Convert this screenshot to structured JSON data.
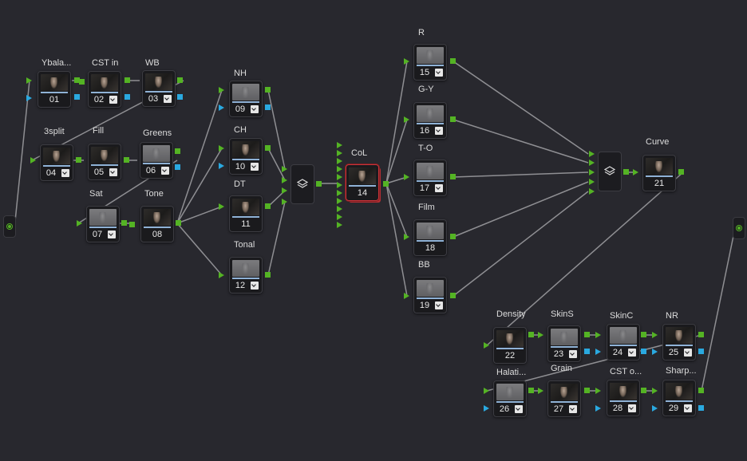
{
  "colors": {
    "background": "#28282e",
    "rgb_port": "#54b324",
    "alpha_port": "#2aa9e0",
    "selected_border": "#c8343a"
  },
  "nodes": [
    {
      "id": "n01",
      "number": "01",
      "label": "Ybala...",
      "thumb": "dark",
      "dropdown": false
    },
    {
      "id": "n02",
      "number": "02",
      "label": "CST in",
      "thumb": "dark",
      "dropdown": true
    },
    {
      "id": "n03",
      "number": "03",
      "label": "WB",
      "thumb": "dark",
      "dropdown": true
    },
    {
      "id": "n04",
      "number": "04",
      "label": "3split",
      "thumb": "dark",
      "dropdown": true
    },
    {
      "id": "n05",
      "number": "05",
      "label": "Fill",
      "thumb": "dark",
      "dropdown": true
    },
    {
      "id": "n06",
      "number": "06",
      "label": "Greens",
      "thumb": "gray",
      "dropdown": true
    },
    {
      "id": "n07",
      "number": "07",
      "label": "Sat",
      "thumb": "gray",
      "dropdown": true
    },
    {
      "id": "n08",
      "number": "08",
      "label": "Tone",
      "thumb": "dark",
      "dropdown": false
    },
    {
      "id": "n09",
      "number": "09",
      "label": "NH",
      "thumb": "gray",
      "dropdown": true
    },
    {
      "id": "n10",
      "number": "10",
      "label": "CH",
      "thumb": "dark",
      "dropdown": true
    },
    {
      "id": "n11",
      "number": "11",
      "label": "DT",
      "thumb": "dark",
      "dropdown": false
    },
    {
      "id": "n12",
      "number": "12",
      "label": "Tonal",
      "thumb": "gray",
      "dropdown": true
    },
    {
      "id": "n14",
      "number": "14",
      "label": "CoL",
      "thumb": "dark",
      "dropdown": false,
      "selected": true
    },
    {
      "id": "n15",
      "number": "15",
      "label": "R",
      "thumb": "gray",
      "dropdown": true
    },
    {
      "id": "n16",
      "number": "16",
      "label": "G-Y",
      "thumb": "gray",
      "dropdown": true
    },
    {
      "id": "n17",
      "number": "17",
      "label": "T-O",
      "thumb": "gray",
      "dropdown": true
    },
    {
      "id": "n18",
      "number": "18",
      "label": "Film",
      "thumb": "gray",
      "dropdown": false
    },
    {
      "id": "n19",
      "number": "19",
      "label": "BB",
      "thumb": "gray",
      "dropdown": true
    },
    {
      "id": "n21",
      "number": "21",
      "label": "Curve",
      "thumb": "dark",
      "dropdown": false
    },
    {
      "id": "n22",
      "number": "22",
      "label": "Density",
      "thumb": "dark",
      "dropdown": false
    },
    {
      "id": "n23",
      "number": "23",
      "label": "SkinS",
      "thumb": "gray",
      "dropdown": true
    },
    {
      "id": "n24",
      "number": "24",
      "label": "SkinC",
      "thumb": "gray",
      "dropdown": true
    },
    {
      "id": "n25",
      "number": "25",
      "label": "NR",
      "thumb": "dark",
      "dropdown": true
    },
    {
      "id": "n26",
      "number": "26",
      "label": "Halati...",
      "thumb": "gray",
      "dropdown": true
    },
    {
      "id": "n27",
      "number": "27",
      "label": "Grain",
      "thumb": "dark",
      "dropdown": true
    },
    {
      "id": "n28",
      "number": "28",
      "label": "CST o...",
      "thumb": "dark",
      "dropdown": true
    },
    {
      "id": "n29",
      "number": "29",
      "label": "Sharp...",
      "thumb": "dark",
      "dropdown": true
    }
  ],
  "mixers": [
    {
      "id": "m1",
      "icon": "layer-mixer-icon"
    },
    {
      "id": "m2",
      "icon": "layer-mixer-icon"
    }
  ],
  "io": [
    {
      "id": "source",
      "icon": "source-input-icon"
    },
    {
      "id": "output",
      "icon": "node-output-icon"
    }
  ]
}
